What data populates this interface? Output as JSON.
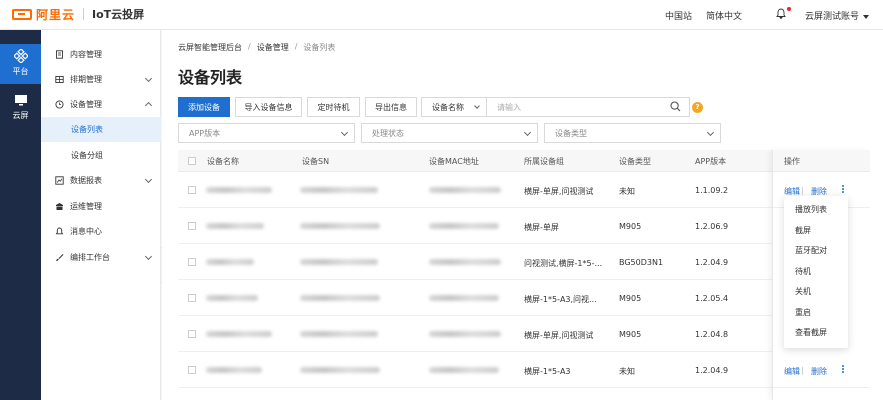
{
  "brand": {
    "logo_text": "阿里云",
    "product": "IoT云投屏"
  },
  "topbar": {
    "region": "中国站",
    "language": "简体中文",
    "account": "云屏测试账号"
  },
  "rail": [
    {
      "label": "平台"
    },
    {
      "label": "云屏"
    }
  ],
  "sidebar": {
    "items": [
      {
        "label": "内容管理"
      },
      {
        "label": "排期管理"
      },
      {
        "label": "设备管理"
      },
      {
        "label": "设备列表"
      },
      {
        "label": "设备分组"
      },
      {
        "label": "数据报表"
      },
      {
        "label": "运维管理"
      },
      {
        "label": "消息中心"
      },
      {
        "label": "编排工作台"
      }
    ]
  },
  "breadcrumb": [
    "云屏智能管理后台",
    "设备管理",
    "设备列表"
  ],
  "page_title": "设备列表",
  "toolbar": {
    "add": "添加设备",
    "import": "导入设备信息",
    "schedule_standby": "定时待机",
    "export": "导出信息",
    "search_field": "设备名称",
    "search_placeholder": "请输入",
    "help": "?"
  },
  "filters": {
    "app_version": "APP版本",
    "status": "处理状态",
    "device_type": "设备类型"
  },
  "table": {
    "columns": [
      "设备名称",
      "设备SN",
      "设备MAC地址",
      "所属设备组",
      "设备类型",
      "APP版本",
      "操作"
    ],
    "rows": [
      {
        "group": "横屏-单屏,问视测试",
        "type": "未知",
        "app": "1.1.09.2"
      },
      {
        "group": "横屏-单屏",
        "type": "M905",
        "app": "1.2.06.9"
      },
      {
        "group": "问视测试,横屏-1*5-...",
        "type": "BG50D3N1",
        "app": "1.2.04.9"
      },
      {
        "group": "横屏-1*5-A3,问视...",
        "type": "M905",
        "app": "1.2.05.4"
      },
      {
        "group": "横屏-单屏,问视测试",
        "type": "M905",
        "app": "1.2.04.8"
      },
      {
        "group": "横屏-1*5-A3",
        "type": "未知",
        "app": "1.2.04.9"
      }
    ],
    "actions": {
      "edit": "编辑",
      "delete": "删除"
    }
  },
  "more_menu": [
    "播放列表",
    "截屏",
    "蓝牙配对",
    "待机",
    "关机",
    "重启",
    "查看截屏"
  ],
  "colors": {
    "brand": "#ff6a00",
    "primary": "#1f6fd0",
    "rail": "#1e2b47"
  }
}
